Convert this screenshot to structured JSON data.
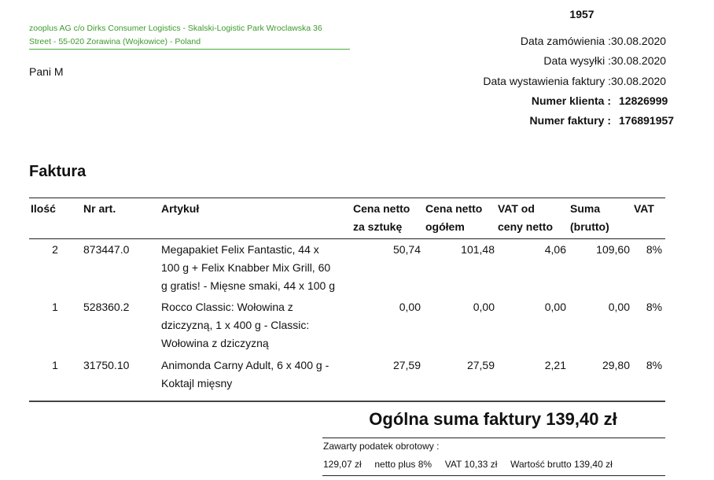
{
  "sender": {
    "line1": "zooplus AG c/o Dirks Consumer Logistics - Skalski-Logistic Park Wroclawska 36",
    "line2": "Street - 55-020 Zorawina (Wojkowice) - Poland"
  },
  "recipient": "Pani M",
  "doc_number": "1957",
  "meta": [
    {
      "label": "Data zamówienia :",
      "value": "30.08.2020",
      "bold": false
    },
    {
      "label": "Data wysyłki :",
      "value": "30.08.2020",
      "bold": false
    },
    {
      "label": "Data wystawienia faktury :",
      "value": "30.08.2020",
      "bold": false
    },
    {
      "label": "Numer klienta :",
      "value": "12826999",
      "bold": true
    },
    {
      "label": "Numer faktury :",
      "value": "176891957",
      "bold": true
    }
  ],
  "title": "Faktura",
  "columns": {
    "qty": [
      "Ilość"
    ],
    "art": [
      "Nr art."
    ],
    "name": [
      "Artykuł"
    ],
    "unit": [
      "Cena netto",
      "za sztukę"
    ],
    "total": [
      "Cena netto",
      "ogółem"
    ],
    "vat": [
      "VAT od",
      "ceny netto"
    ],
    "sum": [
      "Suma",
      "(brutto)"
    ],
    "rate": [
      "VAT"
    ]
  },
  "rows": [
    {
      "qty": "2",
      "art": "873447.0",
      "name": [
        "Megapakiet Felix Fantastic, 44 x",
        "100 g + Felix Knabber Mix Grill, 60",
        "g gratis! - Mięsne smaki, 44 x 100 g"
      ],
      "unit": "50,74",
      "total": "101,48",
      "vat": "4,06",
      "sum": "109,60",
      "rate": "8%"
    },
    {
      "qty": "1",
      "art": "528360.2",
      "name": [
        "Rocco Classic: Wołowina z",
        "dziczyzną, 1 x 400 g - Classic:",
        "Wołowina z dziczyzną"
      ],
      "unit": "0,00",
      "total": "0,00",
      "vat": "0,00",
      "sum": "0,00",
      "rate": "8%"
    },
    {
      "qty": "1",
      "art": "31750.10",
      "name": [
        "Animonda Carny Adult, 6 x 400 g -",
        "Koktajl mięsny"
      ],
      "unit": "27,59",
      "total": "27,59",
      "vat": "2,21",
      "sum": "29,80",
      "rate": "8%"
    }
  ],
  "total_label": "Ogólna suma faktury 139,40 zł",
  "vat_title": "Zawarty podatek obrotowy :",
  "vat_summary": "129,07 zł     netto plus 8%     VAT 10,33 zł     Wartość brutto 139,40 zł"
}
